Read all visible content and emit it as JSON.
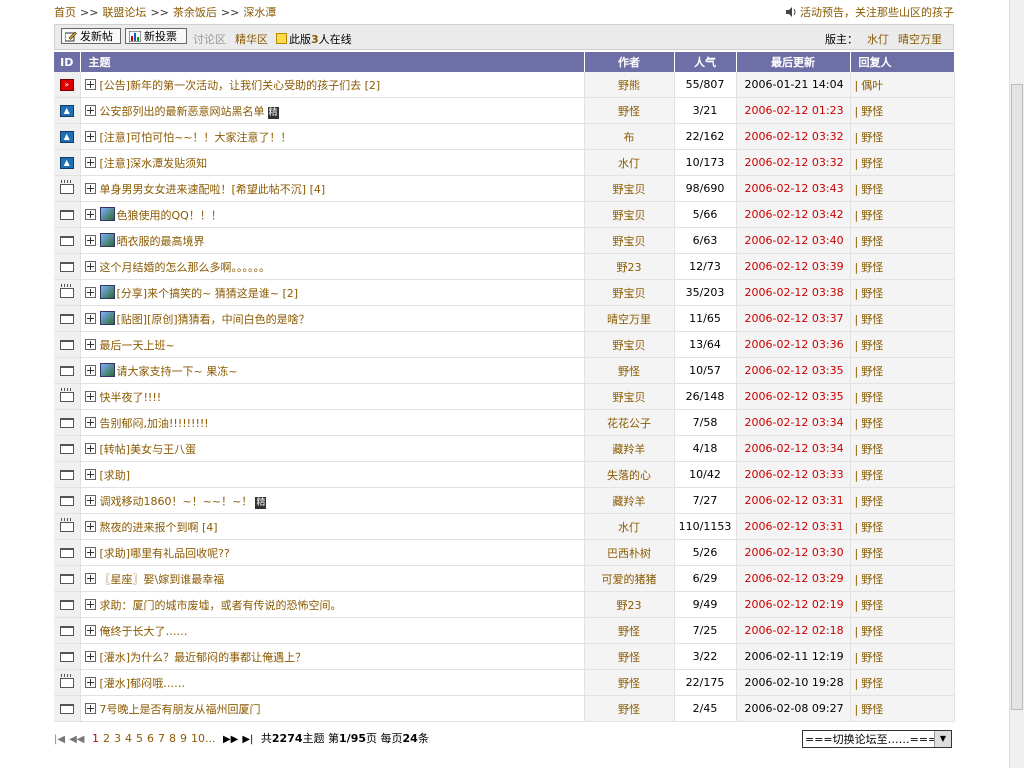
{
  "breadcrumb": [
    "首页",
    "联盟论坛",
    "茶余饭后",
    "深水潭"
  ],
  "notice": "活动预告，关注那些山区的孩子",
  "toolbar": {
    "new_topic": "发新帖",
    "new_poll": "新投票",
    "discuss": "讨论区",
    "elite": "精华区",
    "online_pre": "此版",
    "online_count": "3",
    "online_post": "人在线",
    "mod_label": "版主：",
    "mods": [
      "水仃",
      "晴空万里"
    ]
  },
  "columns": [
    "ID",
    "主题",
    "作者",
    "人气",
    "最后更新",
    "回复人"
  ],
  "rows": [
    {
      "icon": "ann",
      "title": "[公告]新年的第一次活动，让我们关心受助的孩子们去",
      "pages": "[2]",
      "pic": false,
      "jing": false,
      "author": "野熊",
      "pop": "55/807",
      "time": "2006-01-21 14:04",
      "time_red": false,
      "reply": "偶叶"
    },
    {
      "icon": "top",
      "title": "公安部列出的最新恶意网站黑名单",
      "pages": "",
      "pic": false,
      "jing": true,
      "author": "野怪",
      "pop": "3/21",
      "time": "2006-02-12 01:23",
      "time_red": true,
      "reply": "野怪"
    },
    {
      "icon": "top",
      "title": "[注意]可怕可怕~~！！大家注意了！！",
      "pages": "",
      "pic": false,
      "jing": false,
      "author": "布",
      "pop": "22/162",
      "time": "2006-02-12 03:32",
      "time_red": true,
      "reply": "野怪"
    },
    {
      "icon": "top",
      "title": "[注意]深水潭发贴须知",
      "pages": "",
      "pic": false,
      "jing": false,
      "author": "水仃",
      "pop": "10/173",
      "time": "2006-02-12 03:32",
      "time_red": true,
      "reply": "野怪"
    },
    {
      "icon": "hot",
      "title": "单身男男女女进来速配啦！[希望此帖不沉]",
      "pages": "[4]",
      "pic": false,
      "jing": false,
      "author": "野宝贝",
      "pop": "98/690",
      "time": "2006-02-12 03:43",
      "time_red": true,
      "reply": "野怪"
    },
    {
      "icon": "folder",
      "title": "色狼使用的QQ！！！",
      "pages": "",
      "pic": true,
      "jing": false,
      "author": "野宝贝",
      "pop": "5/66",
      "time": "2006-02-12 03:42",
      "time_red": true,
      "reply": "野怪"
    },
    {
      "icon": "folder",
      "title": "晒衣服的最高境界",
      "pages": "",
      "pic": true,
      "jing": false,
      "author": "野宝贝",
      "pop": "6/63",
      "time": "2006-02-12 03:40",
      "time_red": true,
      "reply": "野怪"
    },
    {
      "icon": "folder",
      "title": "这个月结婚的怎么那么多啊。。。。。。",
      "pages": "",
      "pic": false,
      "jing": false,
      "author": "野23",
      "pop": "12/73",
      "time": "2006-02-12 03:39",
      "time_red": true,
      "reply": "野怪"
    },
    {
      "icon": "hot",
      "title": "[分享]来个搞笑的~ 猜猜这是谁~",
      "pages": "[2]",
      "pic": true,
      "jing": false,
      "author": "野宝贝",
      "pop": "35/203",
      "time": "2006-02-12 03:38",
      "time_red": true,
      "reply": "野怪"
    },
    {
      "icon": "folder",
      "title": "[贴图][原创]猜猜看，中间白色的是啥？",
      "pages": "",
      "pic": true,
      "jing": false,
      "author": "晴空万里",
      "pop": "11/65",
      "time": "2006-02-12 03:37",
      "time_red": true,
      "reply": "野怪"
    },
    {
      "icon": "folder",
      "title": "最后一天上班~",
      "pages": "",
      "pic": false,
      "jing": false,
      "author": "野宝贝",
      "pop": "13/64",
      "time": "2006-02-12 03:36",
      "time_red": true,
      "reply": "野怪"
    },
    {
      "icon": "folder",
      "title": "请大家支持一下~ 果冻~",
      "pages": "",
      "pic": true,
      "jing": false,
      "author": "野怪",
      "pop": "10/57",
      "time": "2006-02-12 03:35",
      "time_red": true,
      "reply": "野怪"
    },
    {
      "icon": "hot",
      "title": "快半夜了!!!!",
      "pages": "",
      "pic": false,
      "jing": false,
      "author": "野宝贝",
      "pop": "26/148",
      "time": "2006-02-12 03:35",
      "time_red": true,
      "reply": "野怪"
    },
    {
      "icon": "folder",
      "title": "告别郁闷,加油!!!!!!!!!",
      "pages": "",
      "pic": false,
      "jing": false,
      "author": "花花公子",
      "pop": "7/58",
      "time": "2006-02-12 03:34",
      "time_red": true,
      "reply": "野怪"
    },
    {
      "icon": "folder",
      "title": "[转帖]美女与王八蛋",
      "pages": "",
      "pic": false,
      "jing": false,
      "author": "藏羚羊",
      "pop": "4/18",
      "time": "2006-02-12 03:34",
      "time_red": true,
      "reply": "野怪"
    },
    {
      "icon": "folder",
      "title": "[求助]",
      "pages": "",
      "pic": false,
      "jing": false,
      "author": "失落的心",
      "pop": "10/42",
      "time": "2006-02-12 03:33",
      "time_red": true,
      "reply": "野怪"
    },
    {
      "icon": "folder",
      "title": "调戏移动1860！~！~~！~！",
      "pages": "",
      "pic": false,
      "jing": true,
      "author": "藏羚羊",
      "pop": "7/27",
      "time": "2006-02-12 03:31",
      "time_red": true,
      "reply": "野怪"
    },
    {
      "icon": "hot",
      "title": "熬夜的进来报个到啊",
      "pages": "[4]",
      "pic": false,
      "jing": false,
      "author": "水仃",
      "pop": "110/1153",
      "time": "2006-02-12 03:31",
      "time_red": true,
      "reply": "野怪"
    },
    {
      "icon": "folder",
      "title": "[求助]哪里有礼品回收呢??",
      "pages": "",
      "pic": false,
      "jing": false,
      "author": "巴西朴树",
      "pop": "5/26",
      "time": "2006-02-12 03:30",
      "time_red": true,
      "reply": "野怪"
    },
    {
      "icon": "folder",
      "title": "〖星座〗娶\\嫁到谁最幸福",
      "pages": "",
      "pic": false,
      "jing": false,
      "author": "可爱的猪猪",
      "pop": "6/29",
      "time": "2006-02-12 03:29",
      "time_red": true,
      "reply": "野怪"
    },
    {
      "icon": "folder",
      "title": "求助：厦门的城市废墟，或者有传说的恐怖空间。",
      "pages": "",
      "pic": false,
      "jing": false,
      "author": "野23",
      "pop": "9/49",
      "time": "2006-02-12 02:19",
      "time_red": true,
      "reply": "野怪"
    },
    {
      "icon": "folder",
      "title": "俺终于长大了……",
      "pages": "",
      "pic": false,
      "jing": false,
      "author": "野怪",
      "pop": "7/25",
      "time": "2006-02-12 02:18",
      "time_red": true,
      "reply": "野怪"
    },
    {
      "icon": "folder",
      "title": "[灌水]为什么？最近郁闷的事都让俺遇上？",
      "pages": "",
      "pic": false,
      "jing": false,
      "author": "野怪",
      "pop": "3/22",
      "time": "2006-02-11 12:19",
      "time_red": false,
      "reply": "野怪"
    },
    {
      "icon": "hot",
      "title": "[灌水]郁闷哦……",
      "pages": "",
      "pic": false,
      "jing": false,
      "author": "野怪",
      "pop": "22/175",
      "time": "2006-02-10 19:28",
      "time_red": false,
      "reply": "野怪"
    },
    {
      "icon": "folder",
      "title": "7号晚上是否有朋友从福州回厦门",
      "pages": "",
      "pic": false,
      "jing": false,
      "author": "野怪",
      "pop": "2/45",
      "time": "2006-02-08 09:27",
      "time_red": false,
      "reply": "野怪"
    }
  ],
  "pager": {
    "pages": [
      "1",
      "2",
      "3",
      "4",
      "5",
      "6",
      "7",
      "8",
      "9",
      "10..."
    ],
    "total_pre": "共",
    "total": "2274",
    "total_post": "主题",
    "page_pre": "第",
    "page_cur": "1/95",
    "page_post": "页",
    "per_pre": "每页",
    "per": "24",
    "per_post": "条"
  },
  "forum_switch": "===切换论坛至……===="
}
